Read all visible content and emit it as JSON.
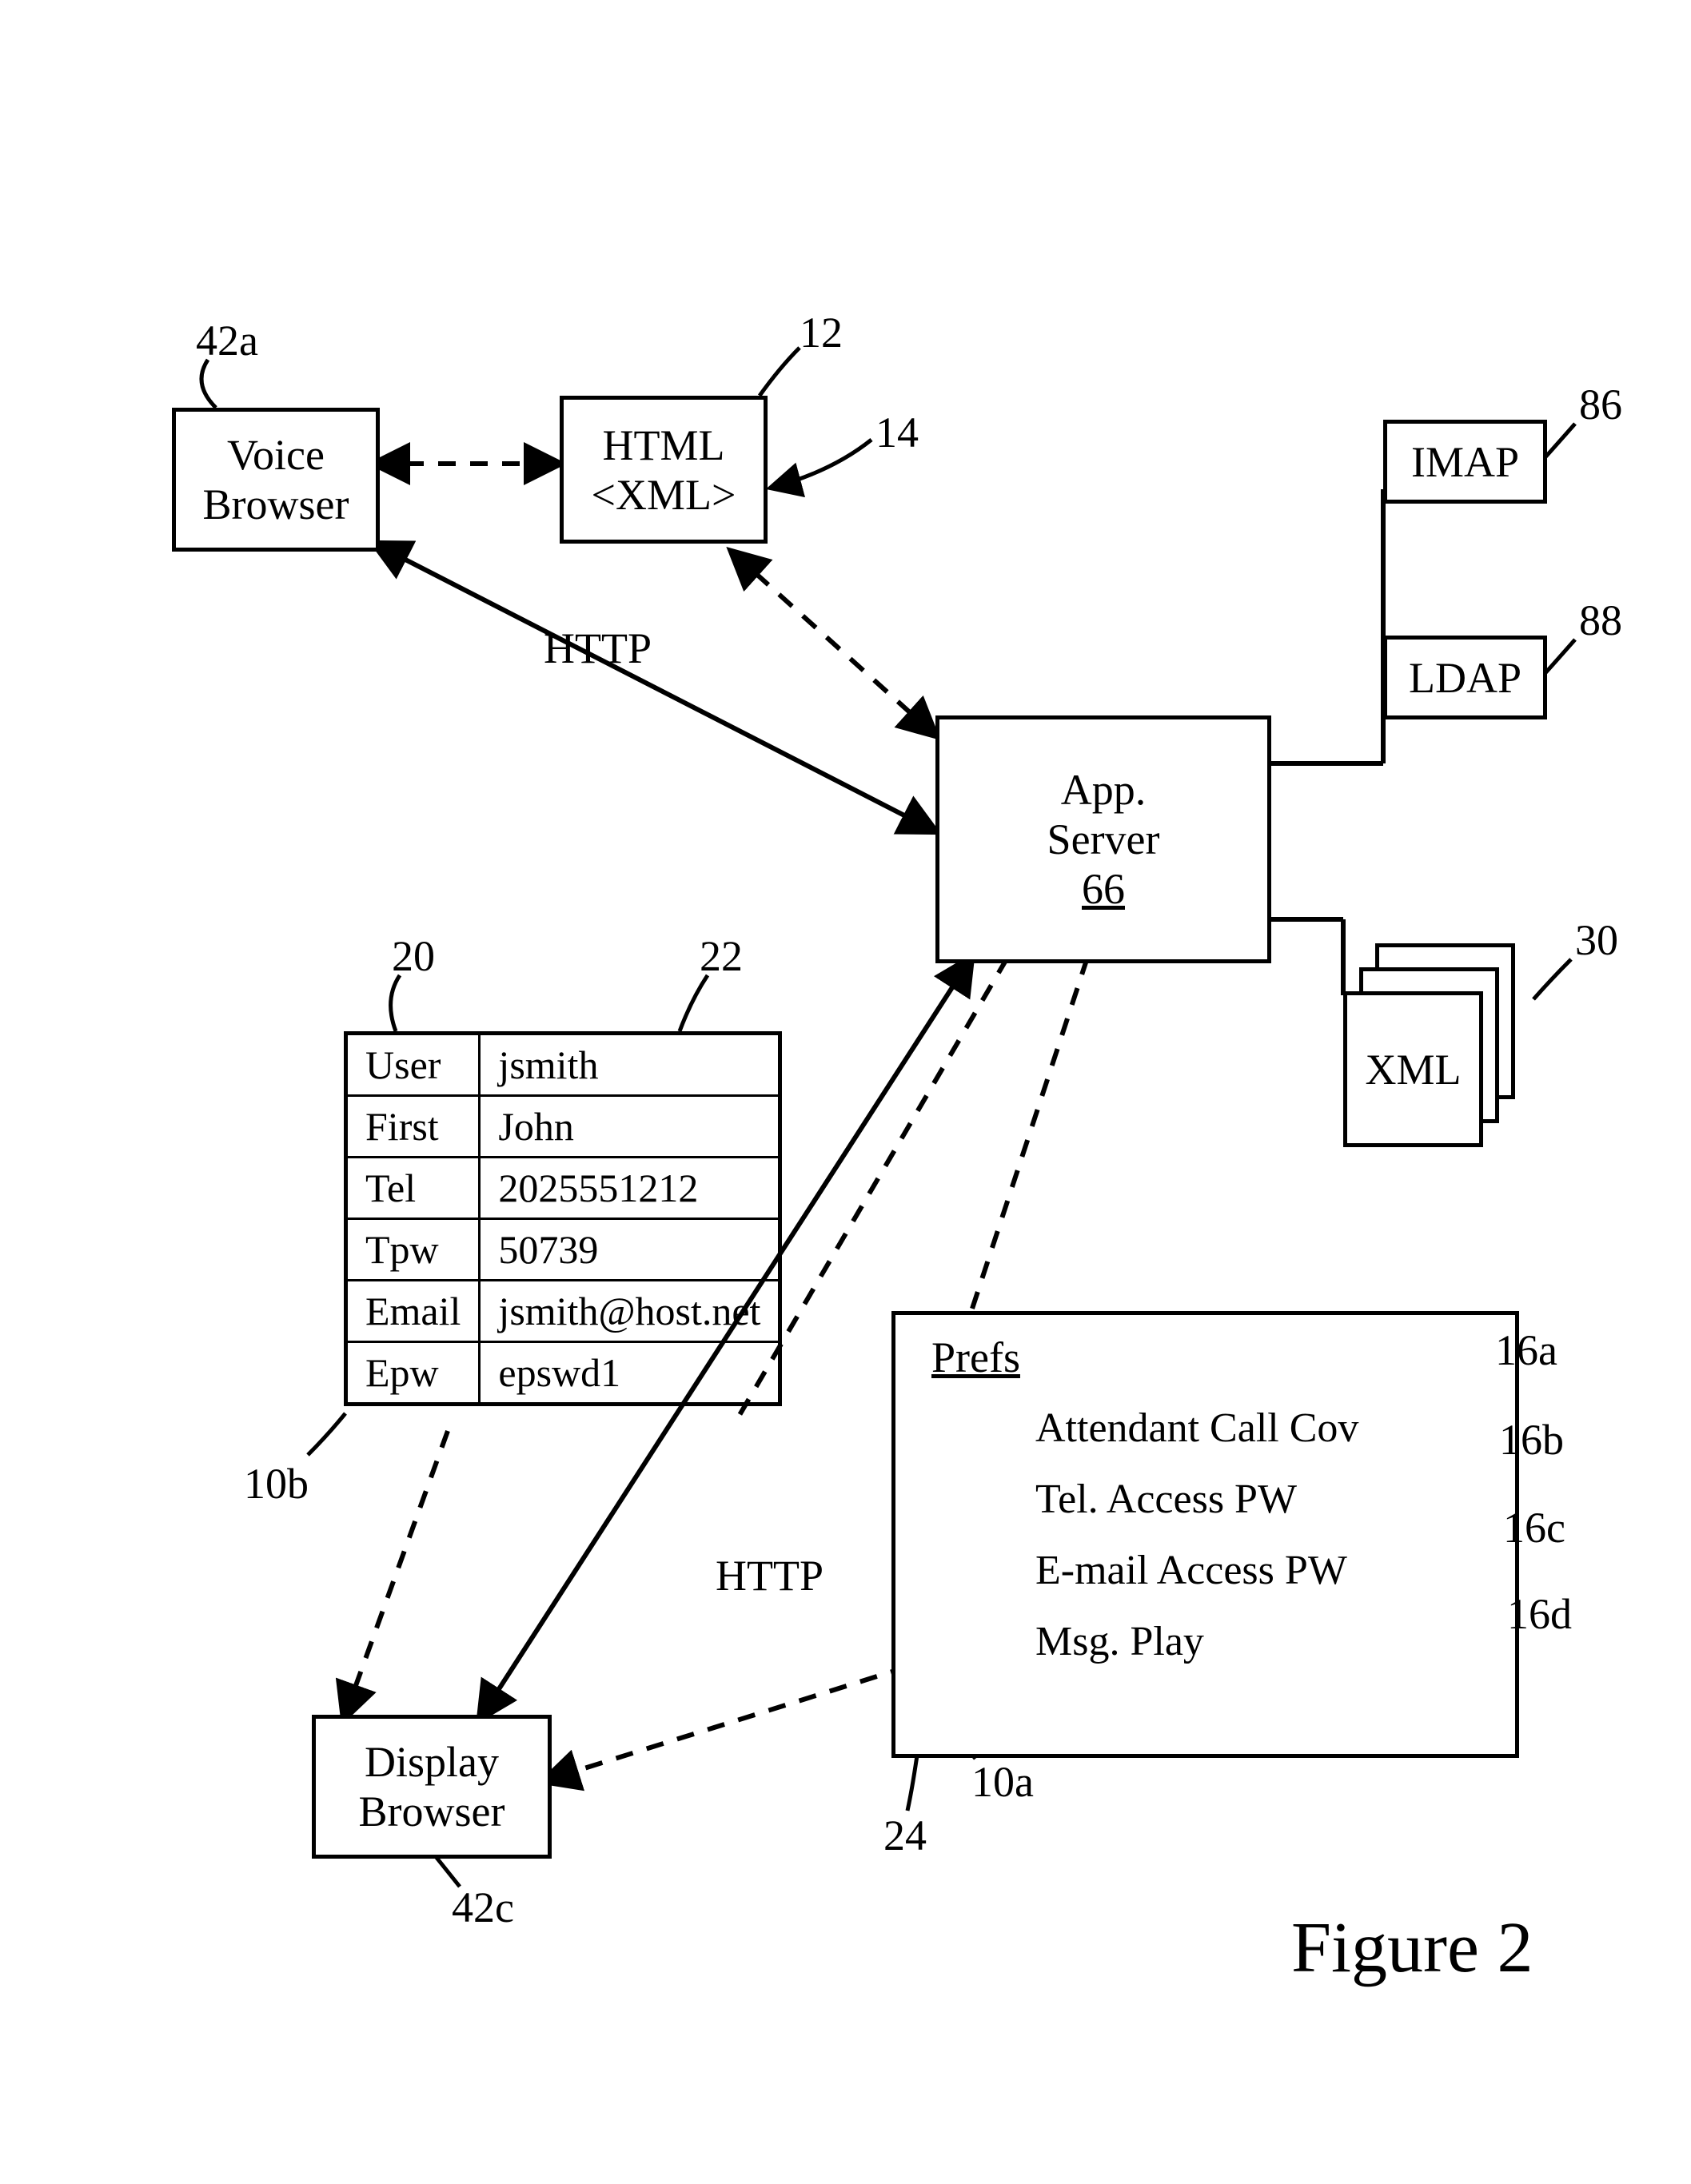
{
  "voice_browser": {
    "line1": "Voice",
    "line2": "Browser",
    "ref": "42a"
  },
  "html_xml": {
    "line1": "HTML",
    "line2": "<XML>",
    "ref_box": "12",
    "ref_content": "14"
  },
  "http_upper": "HTTP",
  "http_lower": "HTTP",
  "app_server": {
    "line1": "App.",
    "line2": "Server",
    "num": "66"
  },
  "imap": {
    "label": "IMAP",
    "ref": "86"
  },
  "ldap": {
    "label": "LDAP",
    "ref": "88"
  },
  "xml_stack": {
    "label": "XML",
    "ref": "30"
  },
  "display_browser": {
    "line1": "Display",
    "line2": "Browser",
    "ref": "42c"
  },
  "user_table": {
    "ref_left": "20",
    "ref_right": "22",
    "ref_group": "10b",
    "rows": [
      {
        "key": "User",
        "val": "jsmith"
      },
      {
        "key": "First",
        "val": "John"
      },
      {
        "key": "Tel",
        "val": "2025551212"
      },
      {
        "key": "Tpw",
        "val": "50739"
      },
      {
        "key": "Email",
        "val": "jsmith@host.net"
      },
      {
        "key": "Epw",
        "val": "epswd1"
      }
    ]
  },
  "prefs_box": {
    "title": "Prefs",
    "ref_title": "24",
    "ref_box": "10a",
    "items": [
      {
        "label": "Attendant Call Cov",
        "ref": "16a"
      },
      {
        "label": "Tel. Access PW",
        "ref": "16b"
      },
      {
        "label": "E-mail Access PW",
        "ref": "16c"
      },
      {
        "label": "Msg. Play",
        "ref": "16d"
      }
    ]
  },
  "figure_label": "Figure 2"
}
